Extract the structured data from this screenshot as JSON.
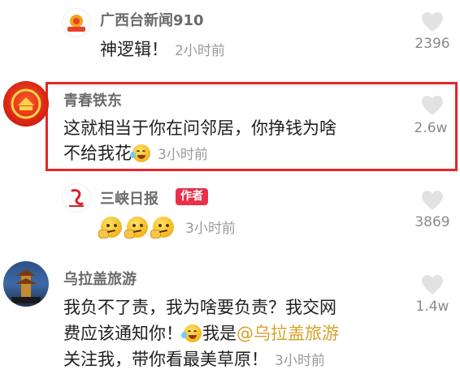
{
  "comments": [
    {
      "username": "广西台新闻910",
      "text": "神逻辑！",
      "time": "2小时前",
      "likes": "2396"
    },
    {
      "username": "青春铁东",
      "line1": "这就相当于你在问邻居，你挣钱为啥",
      "line2": "不给我花",
      "time": "3小时前",
      "likes": "2.6w",
      "highlighted": true
    },
    {
      "username": "三峡日报",
      "badge": "作者",
      "time": "3小时前",
      "likes": "3869"
    },
    {
      "username": "乌拉盖旅游",
      "line1": "我负不了责，我为啥要负责？我交网",
      "line2_pre": "费应该通知你！",
      "line2_mid": "我是",
      "mention": "@乌拉盖旅游",
      "line3": "关注我，带你看最美草原！",
      "time": "3小时前",
      "likes": "1.4w"
    }
  ],
  "icons": {
    "like": "heart-icon",
    "laugh_emoji": "tears-of-joy-emoji-icon",
    "thinking_emoji": "thinking-face-emoji-icon"
  },
  "colors": {
    "highlight_border": "#e4262b",
    "badge": "#e8304a",
    "mention": "#d9a028"
  }
}
